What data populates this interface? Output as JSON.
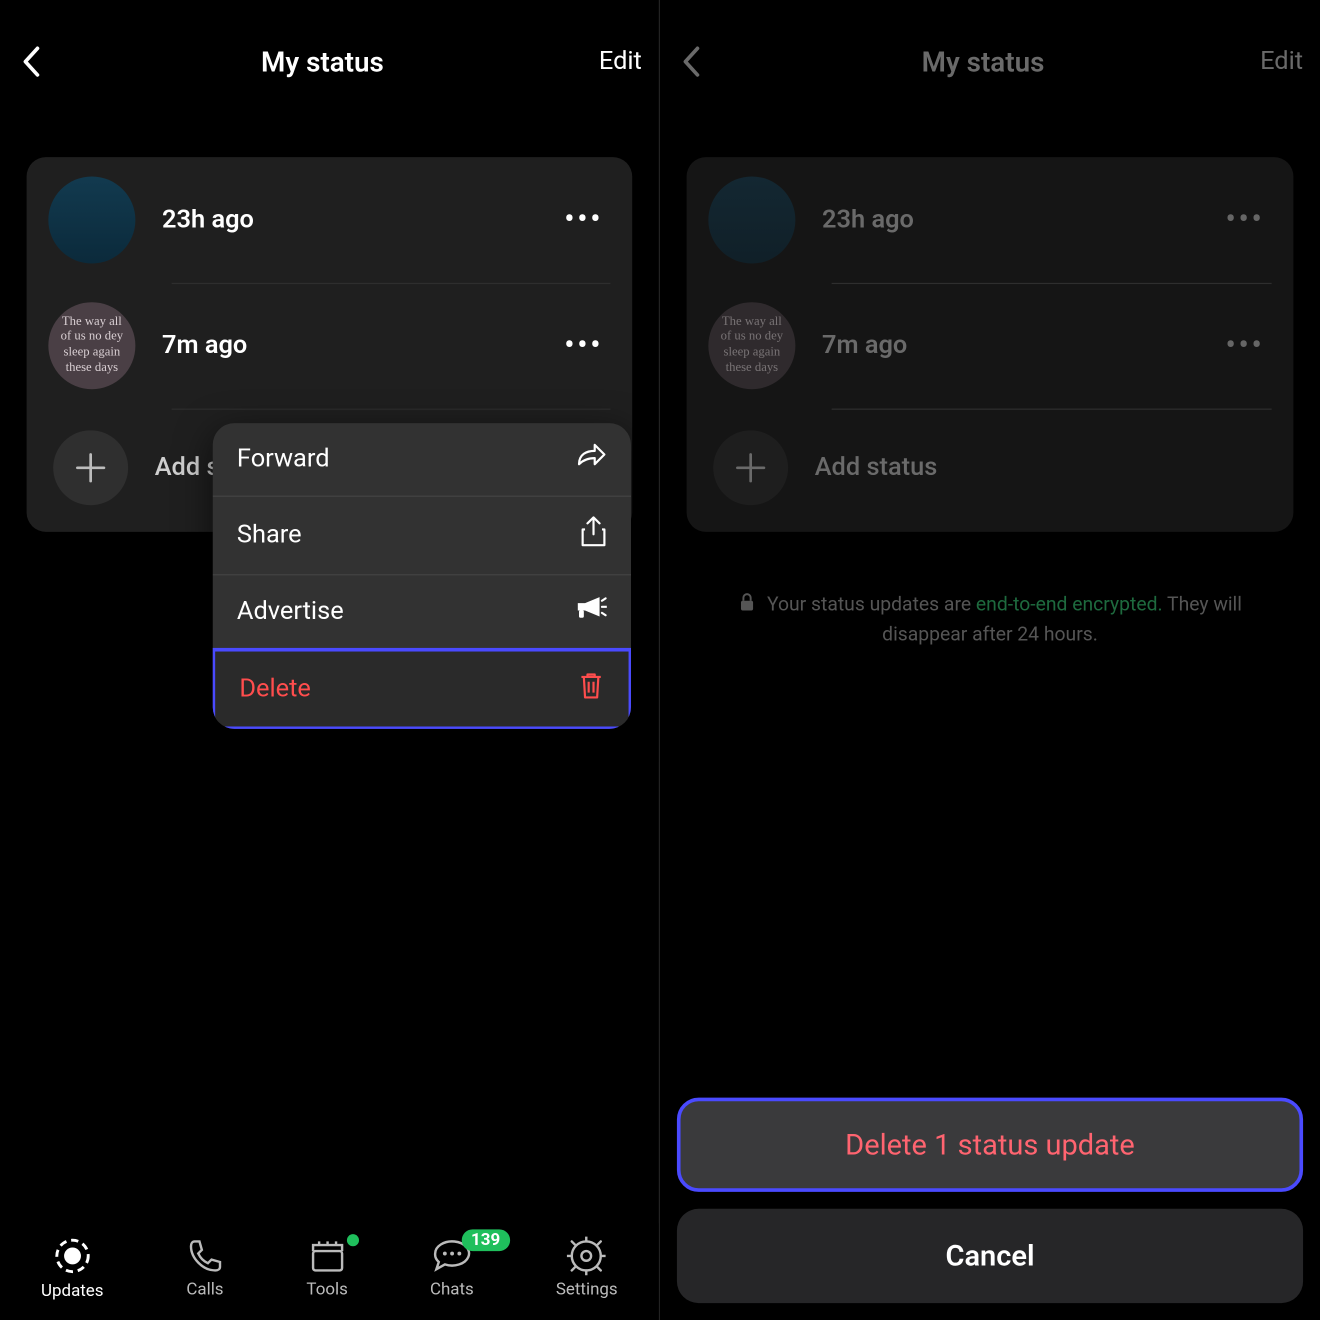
{
  "header": {
    "title": "My status",
    "edit": "Edit"
  },
  "statuses": [
    {
      "time": "23h ago",
      "thumb_text": ""
    },
    {
      "time": "7m ago",
      "thumb_text": "The way all of us no dey sleep again these days"
    }
  ],
  "add_status_label": "Add status",
  "encryption_note": {
    "prefix": "Your status updates are ",
    "highlight": "end-to-end encrypted.",
    "suffix": " They will disappear after 24 hours."
  },
  "context_menu": {
    "forward": "Forward",
    "share": "Share",
    "advertise": "Advertise",
    "delete": "Delete"
  },
  "tabs": {
    "updates": "Updates",
    "calls": "Calls",
    "tools": "Tools",
    "chats": "Chats",
    "settings": "Settings",
    "chats_badge": "139"
  },
  "action_sheet": {
    "delete": "Delete 1 status update",
    "cancel": "Cancel"
  }
}
